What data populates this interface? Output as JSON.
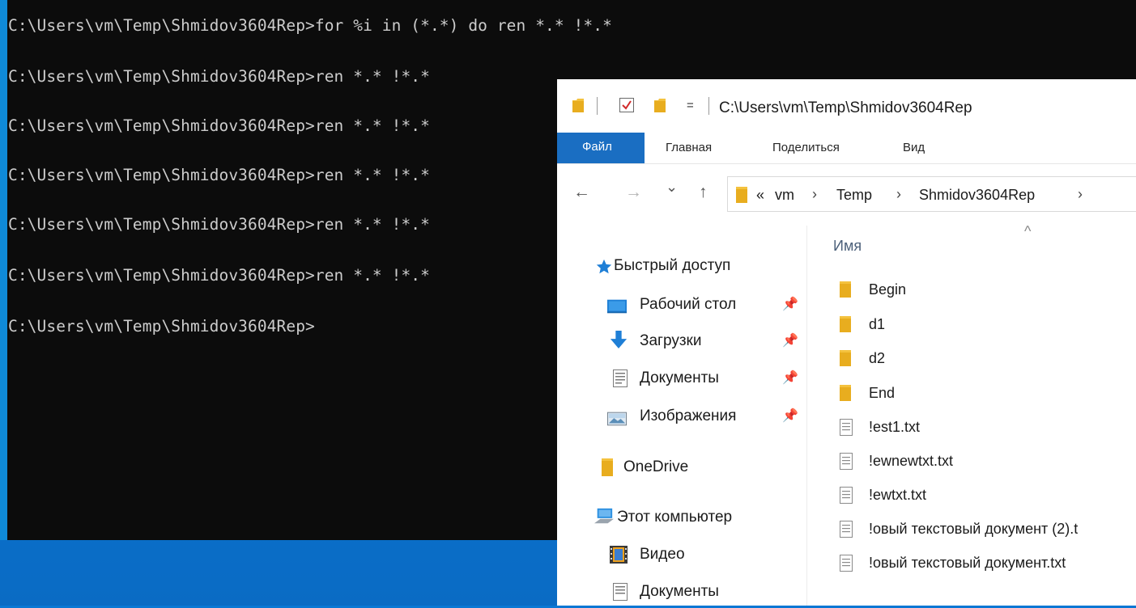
{
  "console": {
    "lines": [
      "C:\\Users\\vm\\Temp\\Shmidov3604Rep>for %i in (*.*) do ren *.* !*.*",
      "C:\\Users\\vm\\Temp\\Shmidov3604Rep>ren *.* !*.*",
      "C:\\Users\\vm\\Temp\\Shmidov3604Rep>ren *.* !*.*",
      "C:\\Users\\vm\\Temp\\Shmidov3604Rep>ren *.* !*.*",
      "C:\\Users\\vm\\Temp\\Shmidov3604Rep>ren *.* !*.*",
      "C:\\Users\\vm\\Temp\\Shmidov3604Rep>ren *.* !*.*",
      "C:\\Users\\vm\\Temp\\Shmidov3604Rep>"
    ]
  },
  "explorer": {
    "title": "C:\\Users\\vm\\Temp\\Shmidov3604Rep",
    "qat_dropdown": "=",
    "ribbon": {
      "file": "Файл",
      "home": "Главная",
      "share": "Поделиться",
      "view": "Вид"
    },
    "nav_buttons": {
      "back": "←",
      "forward": "→",
      "recent": "⌄",
      "up": "↑"
    },
    "address": {
      "overflow": "«",
      "crumbs": [
        "vm",
        "Temp",
        "Shmidov3604Rep"
      ],
      "separator": "›"
    },
    "navpane": {
      "quick_access": "Быстрый доступ",
      "desktop": "Рабочий стол",
      "downloads": "Загрузки",
      "documents": "Документы",
      "pictures": "Изображения",
      "onedrive": "OneDrive",
      "this_pc": "Этот компьютер",
      "videos": "Видео",
      "documents2": "Документы"
    },
    "files": {
      "sort_caret": "^",
      "column_name": "Имя",
      "items": [
        {
          "name": "Begin",
          "type": "folder"
        },
        {
          "name": "d1",
          "type": "folder"
        },
        {
          "name": "d2",
          "type": "folder"
        },
        {
          "name": "End",
          "type": "folder"
        },
        {
          "name": "!est1.txt",
          "type": "text"
        },
        {
          "name": "!ewnewtxt.txt",
          "type": "text"
        },
        {
          "name": "!ewtxt.txt",
          "type": "text"
        },
        {
          "name": "!овый текстовый документ (2).t",
          "type": "text"
        },
        {
          "name": "!овый текстовый документ.txt",
          "type": "text"
        }
      ]
    }
  },
  "colors": {
    "console_bg": "#0c0c0c",
    "console_text": "#cccccc",
    "ribbon_file_bg": "#1a6ec2",
    "desktop_blue": "#0b74cf",
    "folder_yellow": "#f4c23e"
  }
}
